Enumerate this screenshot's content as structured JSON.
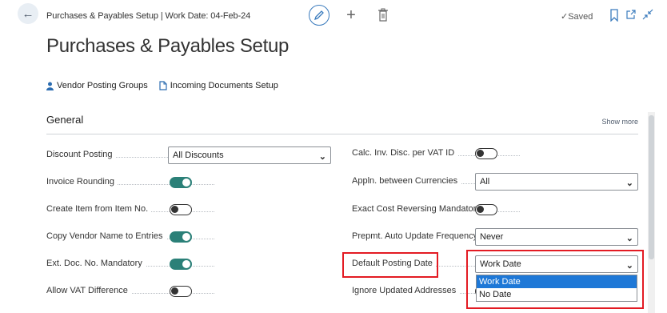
{
  "header": {
    "breadcrumb": "Purchases & Payables Setup | Work Date: 04-Feb-24",
    "saved_label": "✓Saved",
    "icons": {
      "back": "back-arrow-icon",
      "edit": "pencil-icon",
      "new": "plus-icon",
      "delete": "trash-icon",
      "bookmark": "bookmark-icon",
      "popout": "open-new-window-icon",
      "collapse": "collapse-icon"
    }
  },
  "page": {
    "title": "Purchases & Payables Setup"
  },
  "actions": [
    {
      "label": "Vendor Posting Groups",
      "icon": "person-icon"
    },
    {
      "label": "Incoming Documents Setup",
      "icon": "document-icon"
    }
  ],
  "section": {
    "title": "General",
    "show_more": "Show more"
  },
  "left_fields": [
    {
      "label": "Discount Posting",
      "type": "select",
      "value": "All Discounts"
    },
    {
      "label": "Invoice Rounding",
      "type": "toggle",
      "value": true
    },
    {
      "label": "Create Item from Item No.",
      "type": "toggle",
      "value": false
    },
    {
      "label": "Copy Vendor Name to Entries",
      "type": "toggle",
      "value": true
    },
    {
      "label": "Ext. Doc. No. Mandatory",
      "type": "toggle",
      "value": true
    },
    {
      "label": "Allow VAT Difference",
      "type": "toggle",
      "value": false
    }
  ],
  "right_fields": [
    {
      "label": "Calc. Inv. Disc. per VAT ID",
      "type": "toggle",
      "value": false
    },
    {
      "label": "Appln. between Currencies",
      "type": "select",
      "value": "All"
    },
    {
      "label": "Exact Cost Reversing Mandatory",
      "type": "toggle",
      "value": false
    },
    {
      "label": "Prepmt. Auto Update Frequency",
      "type": "select",
      "value": "Never"
    },
    {
      "label": "Default Posting Date",
      "type": "select",
      "value": "Work Date"
    },
    {
      "label": "Ignore Updated Addresses",
      "type": "toggle",
      "value": false
    }
  ],
  "dropdown_options": [
    "Work Date",
    "No Date"
  ],
  "colors": {
    "toggle_on": "#2b8078",
    "highlight": "#e31b23",
    "selected_option": "#1e78d7",
    "accent": "#3a7bbd"
  }
}
